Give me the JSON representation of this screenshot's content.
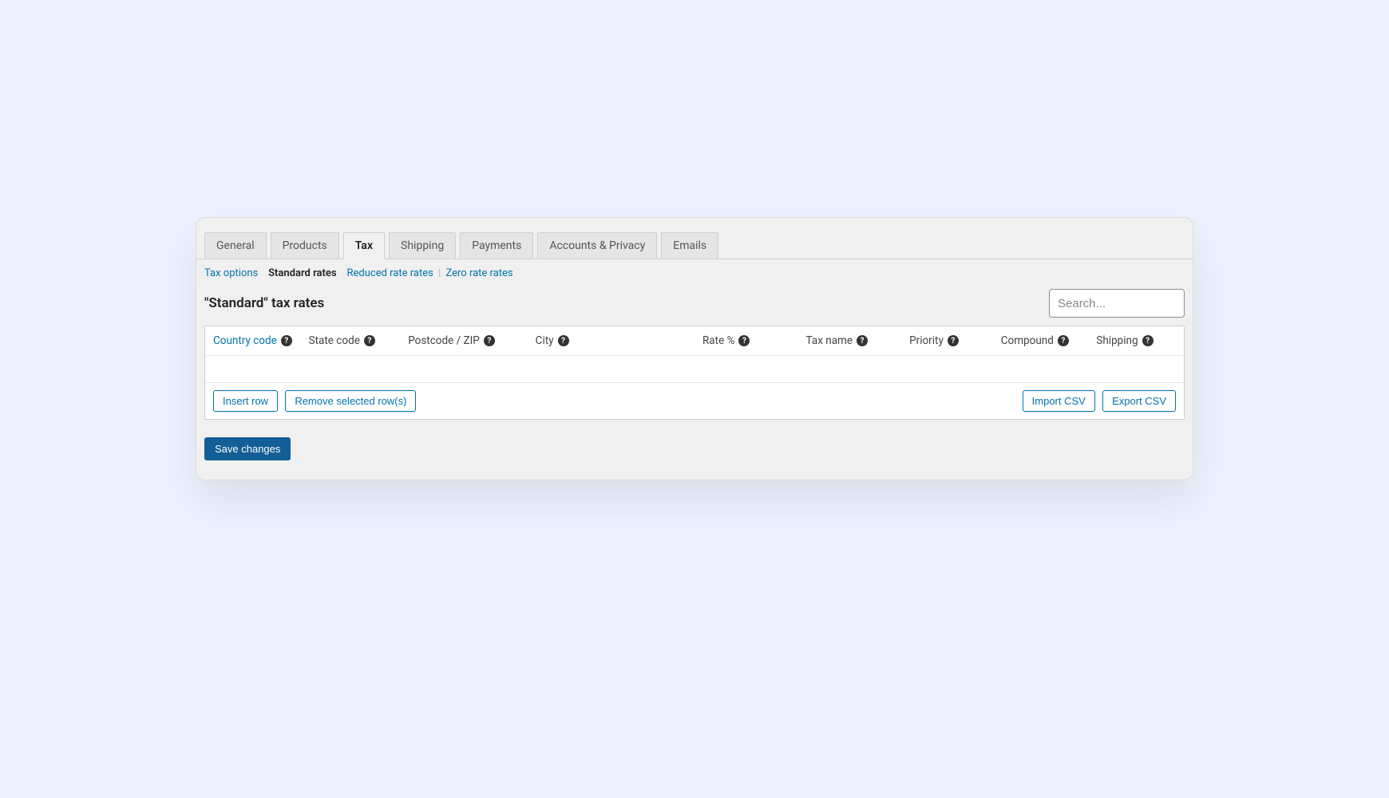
{
  "tabs": {
    "general": "General",
    "products": "Products",
    "tax": "Tax",
    "shipping": "Shipping",
    "payments": "Payments",
    "accounts": "Accounts & Privacy",
    "emails": "Emails"
  },
  "subnav": {
    "tax_options": "Tax options",
    "standard": "Standard rates",
    "reduced": "Reduced rate rates",
    "zero": "Zero rate rates"
  },
  "page_title": "\"Standard\" tax rates",
  "search": {
    "placeholder": "Search..."
  },
  "columns": {
    "country": "Country code",
    "state": "State code",
    "zip": "Postcode / ZIP",
    "city": "City",
    "rate": "Rate %",
    "taxname": "Tax name",
    "priority": "Priority",
    "compound": "Compound",
    "shipping": "Shipping"
  },
  "buttons": {
    "insert": "Insert row",
    "remove": "Remove selected row(s)",
    "import": "Import CSV",
    "export": "Export CSV",
    "save": "Save changes"
  }
}
